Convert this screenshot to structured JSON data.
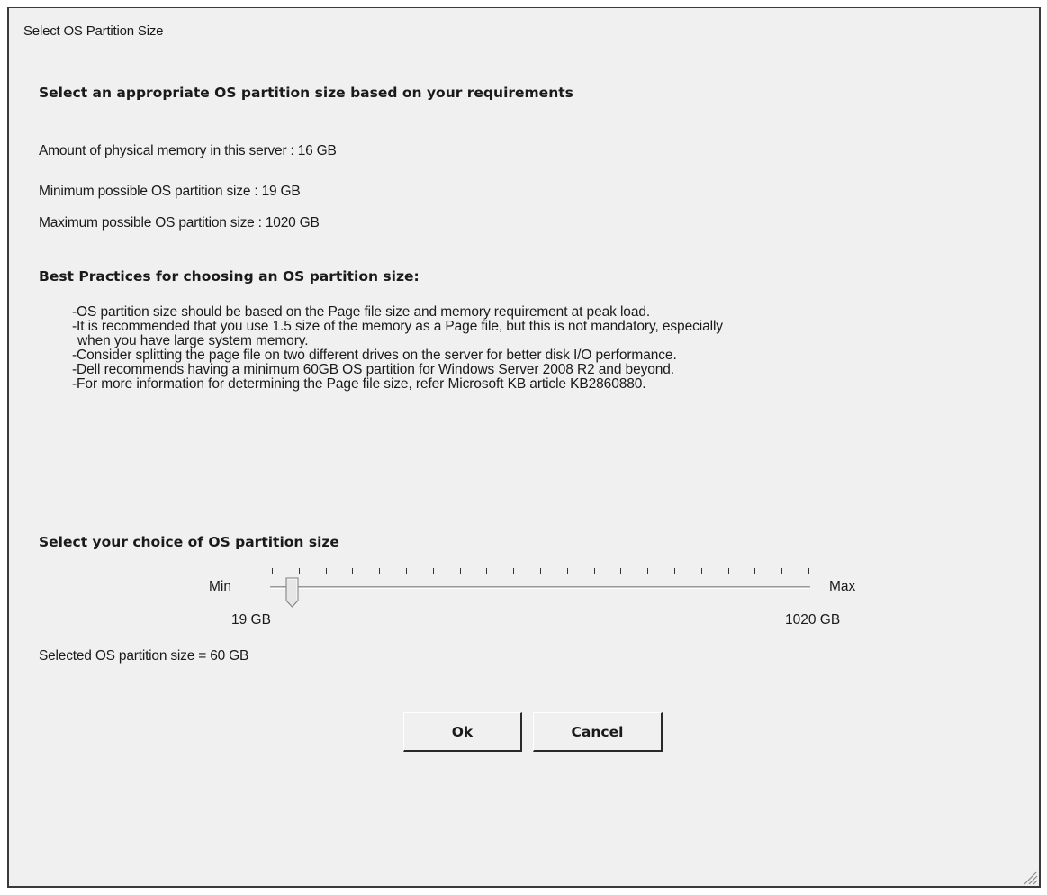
{
  "window": {
    "title": "Select OS Partition Size"
  },
  "main": {
    "heading": "Select an appropriate OS partition size based on your requirements",
    "memory_text": "Amount of physical memory in this server : 16 GB",
    "min_text": "Minimum possible OS partition size  : 19 GB",
    "max_text": "Maximum possible OS partition size  : 1020 GB"
  },
  "best_practices": {
    "heading": "Best Practices for choosing an OS partition size:",
    "lines": [
      "-OS partition size should be based on the Page file size and memory requirement at peak load.",
      "-It is recommended that you use 1.5 size of the memory as a Page file, but this is not mandatory, especially",
      "when you have large system memory.",
      "-Consider splitting the page file on two different drives on the server for better disk I/O performance.",
      "-Dell recommends having a minimum 60GB OS partition for Windows Server 2008 R2 and beyond.",
      "-For more information for determining the Page file size, refer Microsoft KB article KB2860880."
    ]
  },
  "slider": {
    "heading": "Select your choice of OS partition size",
    "min_label": "Min",
    "max_label": "Max",
    "min_value_label": "19  GB",
    "max_value_label": "1020 GB",
    "min_value": 19,
    "max_value": 1020,
    "current_value": 60,
    "tick_count": 21
  },
  "selected_text": "Selected OS partition size = 60 GB",
  "buttons": {
    "ok_label": "Ok",
    "cancel_label": "Cancel"
  }
}
